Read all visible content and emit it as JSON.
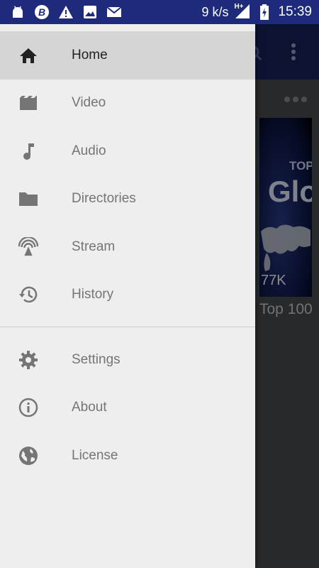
{
  "status_bar": {
    "speed": "9 k/s",
    "network": "H+",
    "time": "15:39"
  },
  "drawer": {
    "items": [
      {
        "label": "Home",
        "icon": "home-icon",
        "selected": true
      },
      {
        "label": "Video",
        "icon": "video-icon"
      },
      {
        "label": "Audio",
        "icon": "music-note-icon"
      },
      {
        "label": "Directories",
        "icon": "folder-icon"
      },
      {
        "label": "Stream",
        "icon": "stream-icon"
      },
      {
        "label": "History",
        "icon": "history-icon"
      }
    ],
    "secondary_items": [
      {
        "label": "Settings",
        "icon": "gear-icon"
      },
      {
        "label": "About",
        "icon": "info-icon"
      },
      {
        "label": "License",
        "icon": "globe-icon"
      }
    ]
  },
  "background": {
    "thumbnail_top_text": "TOP",
    "thumbnail_big_text": "Glo",
    "thumbnail_views": "77K",
    "card_title": "Top 100"
  },
  "colors": {
    "status_bar": "#1d2b7a",
    "toolbar": "#17235a",
    "drawer_bg": "#eeeeee",
    "selected_bg": "#d5d5d5"
  }
}
